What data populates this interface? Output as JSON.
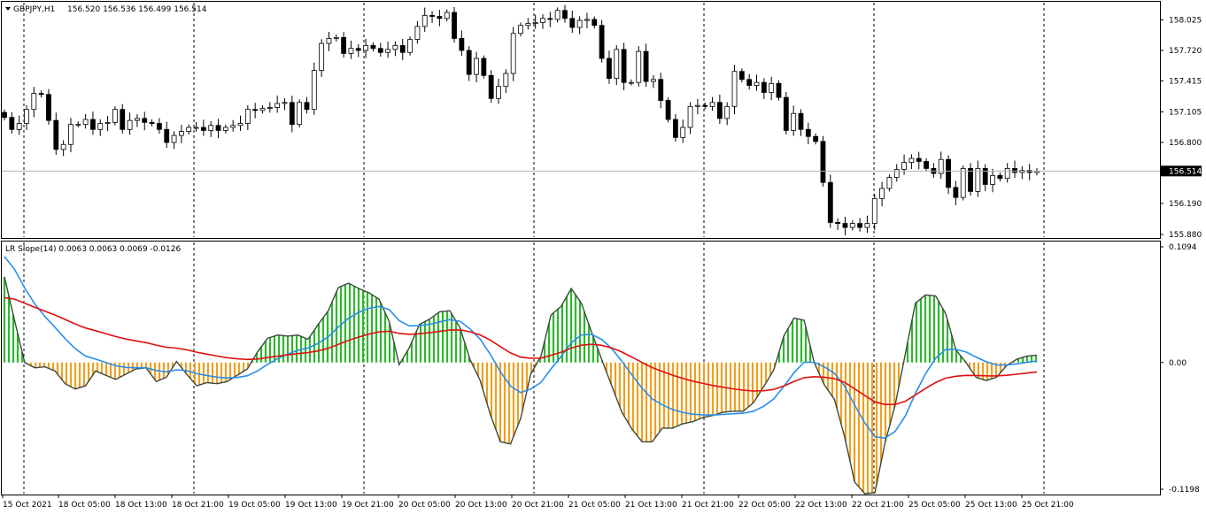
{
  "price_panel": {
    "symbol": "GBPJPY,H1",
    "ohlc": "156.520 156.536 156.499 156.514",
    "current_price": "156.514",
    "ylim": [
      155.88,
      158.18
    ],
    "y_ticks": [
      "158.025",
      "157.720",
      "157.415",
      "157.105",
      "156.800",
      "156.190",
      "155.880"
    ]
  },
  "indicator_panel": {
    "label": "LR Slope(14) 0.0063 0.0063 0.0069 -0.0126",
    "ylim": [
      -0.1198,
      0.1094
    ],
    "y_ticks": [
      "0.1094",
      "0.00",
      "-0.1198"
    ]
  },
  "x_ticks": [
    "15 Oct 2021",
    "18 Oct 05:00",
    "18 Oct 13:00",
    "18 Oct 21:00",
    "19 Oct 05:00",
    "19 Oct 13:00",
    "19 Oct 21:00",
    "20 Oct 05:00",
    "20 Oct 13:00",
    "20 Oct 21:00",
    "21 Oct 05:00",
    "21 Oct 13:00",
    "21 Oct 21:00",
    "22 Oct 05:00",
    "22 Oct 13:00",
    "22 Oct 21:00",
    "25 Oct 05:00",
    "25 Oct 13:00",
    "25 Oct 21:00"
  ],
  "colors": {
    "up_body": "#ffffff",
    "down_body": "#000000",
    "wick": "#000000",
    "hist_up": "#2db82d",
    "hist_down": "#f0a020",
    "slope_line": "#3a4a3a",
    "signal_blue": "#2a8ee8",
    "signal_red": "#e01010",
    "grid": "#000000"
  },
  "chart_data": [
    {
      "type": "candlestick",
      "title": "GBPJPY,H1",
      "ylim": [
        155.88,
        158.18
      ],
      "closes": [
        157.05,
        156.93,
        156.99,
        157.13,
        157.29,
        157.28,
        157.02,
        156.73,
        156.78,
        156.98,
        156.98,
        157.03,
        156.93,
        156.99,
        157.0,
        157.13,
        156.93,
        157.02,
        157.04,
        157.0,
        156.99,
        156.93,
        156.8,
        156.87,
        156.91,
        156.95,
        156.95,
        156.92,
        156.97,
        156.92,
        156.95,
        156.97,
        156.99,
        157.13,
        157.12,
        157.14,
        157.15,
        157.19,
        157.2,
        156.98,
        157.2,
        157.13,
        157.52,
        157.79,
        157.84,
        157.85,
        157.69,
        157.74,
        157.72,
        157.77,
        157.74,
        157.7,
        157.73,
        157.77,
        157.7,
        157.83,
        157.96,
        158.07,
        158.06,
        158.04,
        158.1,
        157.84,
        157.72,
        157.48,
        157.64,
        157.47,
        157.24,
        157.36,
        157.49,
        157.89,
        157.97,
        157.99,
        158.0,
        158.04,
        158.03,
        158.12,
        158.04,
        157.95,
        158.02,
        158.03,
        157.97,
        157.64,
        157.44,
        157.73,
        157.4,
        157.4,
        157.71,
        157.41,
        157.43,
        157.22,
        157.03,
        156.85,
        156.95,
        157.16,
        157.17,
        157.16,
        157.2,
        157.04,
        157.16,
        157.51,
        157.43,
        157.37,
        157.4,
        157.3,
        157.39,
        157.25,
        156.92,
        157.09,
        156.93,
        156.86,
        156.81,
        156.4,
        156.0,
        155.99,
        155.95,
        155.99,
        155.95,
        155.99,
        156.24,
        156.34,
        156.45,
        156.53,
        156.6,
        156.64,
        156.61,
        156.54,
        156.49,
        156.63,
        156.35,
        156.25,
        156.54,
        156.31,
        156.54,
        156.38,
        156.47,
        156.44,
        156.54,
        156.5,
        156.52,
        156.5,
        156.514
      ]
    },
    {
      "type": "line",
      "title": "LR Slope(14)",
      "ylim": [
        -0.1198,
        0.1094
      ],
      "series": [
        {
          "values": [
            0.081,
            0.04,
            0.0,
            -0.005,
            -0.004,
            -0.008,
            -0.02,
            -0.025,
            -0.022,
            -0.008,
            -0.012,
            -0.016,
            -0.011,
            -0.006,
            -0.005,
            -0.018,
            -0.014,
            0.001,
            -0.011,
            -0.022,
            -0.019,
            -0.02,
            -0.018,
            -0.012,
            -0.006,
            0.01,
            0.023,
            0.026,
            0.025,
            0.026,
            0.022,
            0.036,
            0.049,
            0.071,
            0.075,
            0.07,
            0.066,
            0.06,
            0.039,
            -0.002,
            0.014,
            0.036,
            0.041,
            0.048,
            0.049,
            0.033,
            0.003,
            -0.017,
            -0.049,
            -0.075,
            -0.077,
            -0.053,
            -0.011,
            0.006,
            0.045,
            0.053,
            0.07,
            0.056,
            0.029,
            0.003,
            -0.022,
            -0.047,
            -0.063,
            -0.075,
            -0.075,
            -0.062,
            -0.062,
            -0.058,
            -0.056,
            -0.052,
            -0.05,
            -0.047,
            -0.046,
            -0.046,
            -0.038,
            -0.023,
            -0.007,
            0.025,
            0.042,
            0.04,
            0.0,
            -0.021,
            -0.035,
            -0.07,
            -0.113,
            -0.124,
            -0.123,
            -0.076,
            -0.04,
            0.008,
            0.056,
            0.064,
            0.063,
            0.046,
            0.012,
            0.0,
            -0.014,
            -0.017,
            -0.014,
            -0.003,
            0.003,
            0.006,
            0.007
          ]
        }
      ]
    }
  ]
}
